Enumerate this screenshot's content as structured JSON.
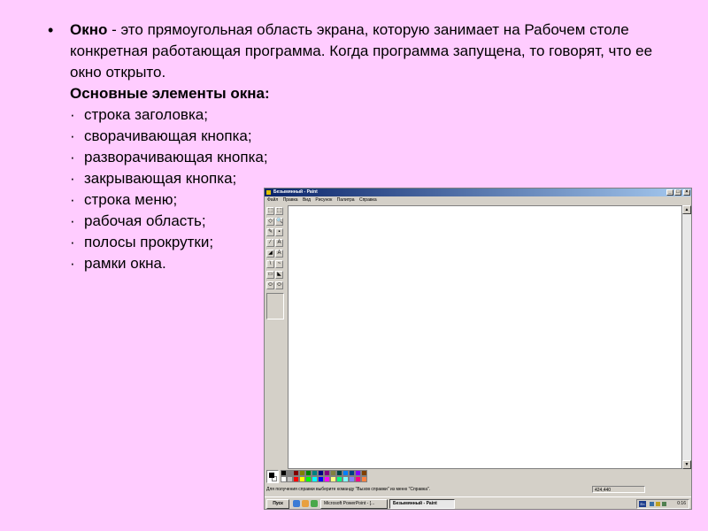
{
  "slide": {
    "bullet": "•",
    "term": "Окно",
    "definition": " - это прямоугольная область экрана, которую занимает на Рабочем столе конкретная работающая программа. Когда программа запущена, то говорят, что ее окно открыто.",
    "heading": "Основные элементы окна:",
    "item_marker": "·",
    "items": [
      "строка заголовка;",
      "сворачивающая кнопка;",
      "разворачивающая кнопка;",
      "закрывающая кнопка;",
      "строка меню;",
      "рабочая область;",
      "полосы прокрутки;",
      "рамки окна."
    ]
  },
  "paint": {
    "title": "Безымянный - Paint",
    "window_buttons": {
      "minimize": "_",
      "maximize": "□",
      "close": "×"
    },
    "menu": [
      "Файл",
      "Правка",
      "Вид",
      "Рисунок",
      "Палитра",
      "Справка"
    ],
    "tools": [
      "⬚",
      "⬚",
      "◇",
      "🔍",
      "✎",
      "▪",
      "⁄",
      "A",
      "◢",
      "A",
      "\\",
      "~",
      "▭",
      "◣",
      "⬭",
      "⬭"
    ],
    "palette_colors": [
      "#000000",
      "#808080",
      "#800000",
      "#808000",
      "#008000",
      "#008080",
      "#000080",
      "#800080",
      "#808040",
      "#004040",
      "#0080ff",
      "#004080",
      "#8000ff",
      "#804000",
      "#ffffff",
      "#c0c0c0",
      "#ff0000",
      "#ffff00",
      "#00ff00",
      "#00ffff",
      "#0000ff",
      "#ff00ff",
      "#ffff80",
      "#00ff80",
      "#80ffff",
      "#8080ff",
      "#ff0080",
      "#ff8040"
    ],
    "status_help": "Для получения справки выберите команду \"Вызов справки\" из меню \"Справка\".",
    "status_coords": "424,440",
    "taskbar": {
      "start": "Пуск",
      "tasks": [
        "Microsoft PowerPoint - [...",
        "Безымянный - Paint"
      ],
      "tray_lang": "En",
      "clock": "0:16"
    }
  }
}
